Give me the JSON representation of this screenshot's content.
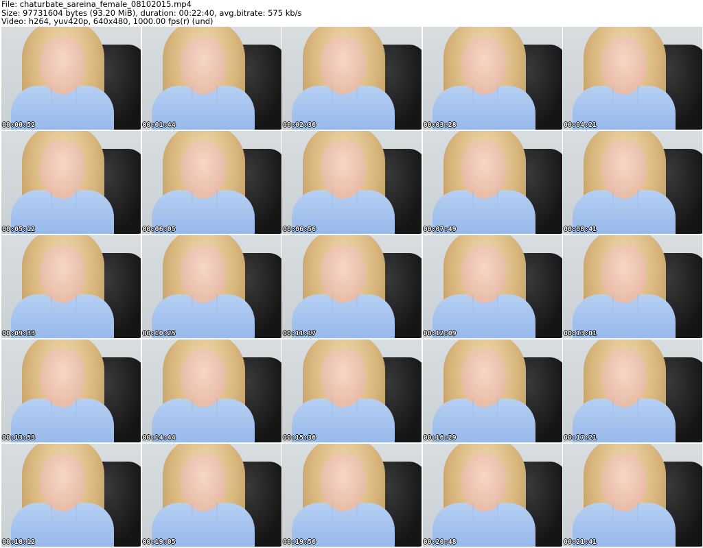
{
  "header": {
    "file_line": "File: chaturbate_sareina_female_08102015.mp4",
    "size_line": "Size: 97731604 bytes (93.20 MiB), duration: 00:22:40, avg.bitrate: 575 kb/s",
    "video_line": "Video: h264, yuv420p, 640x480, 1000.00 fps(r) (und)"
  },
  "thumbnails": [
    {
      "timestamp": "00:00:52"
    },
    {
      "timestamp": "00:01:44"
    },
    {
      "timestamp": "00:02:36"
    },
    {
      "timestamp": "00:03:28"
    },
    {
      "timestamp": "00:04:21"
    },
    {
      "timestamp": "00:05:12"
    },
    {
      "timestamp": "00:06:05"
    },
    {
      "timestamp": "00:06:56"
    },
    {
      "timestamp": "00:07:49"
    },
    {
      "timestamp": "00:08:41"
    },
    {
      "timestamp": "00:09:33"
    },
    {
      "timestamp": "00:10:25"
    },
    {
      "timestamp": "00:11:17"
    },
    {
      "timestamp": "00:12:09"
    },
    {
      "timestamp": "00:13:01"
    },
    {
      "timestamp": "00:13:53"
    },
    {
      "timestamp": "00:14:44"
    },
    {
      "timestamp": "00:15:36"
    },
    {
      "timestamp": "00:16:29"
    },
    {
      "timestamp": "00:17:21"
    },
    {
      "timestamp": "00:18:12"
    },
    {
      "timestamp": "00:19:05"
    },
    {
      "timestamp": "00:19:56"
    },
    {
      "timestamp": "00:20:48"
    },
    {
      "timestamp": "00:21:41"
    }
  ]
}
